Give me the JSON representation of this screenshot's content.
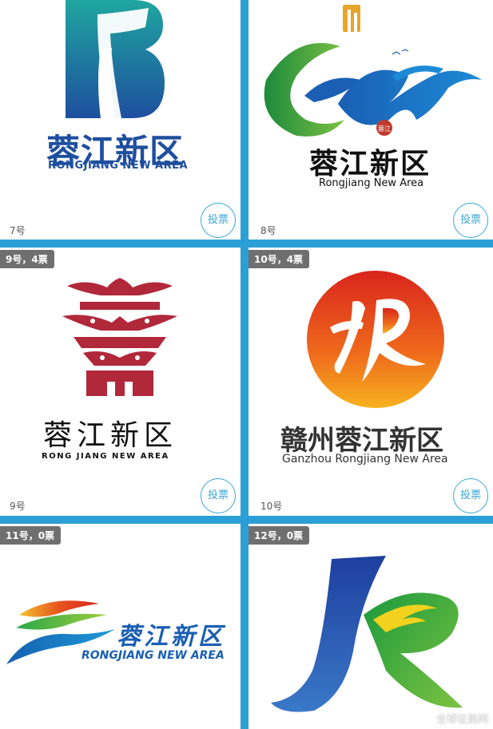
{
  "entries": [
    {
      "number": "7号",
      "vote_label": "投票",
      "cn_title": "蓉江新区",
      "en_title": "RONGJIANG NEW AREA"
    },
    {
      "number": "8号",
      "vote_label": "投票",
      "cn_title": "蓉江新区",
      "en_title": "Rongjiang New Area",
      "seal_text": "蓉江"
    },
    {
      "number": "9号",
      "badge": "9号，4票",
      "vote_label": "投票",
      "cn_title": "蓉江新区",
      "en_title": "RONG JIANG NEW AREA"
    },
    {
      "number": "10号",
      "badge": "10号，4票",
      "vote_label": "投票",
      "cn_title": "赣州蓉江新区",
      "en_title": "Ganzhou Rongjiang New Area"
    },
    {
      "badge": "11号，0票",
      "cn_title": "蓉江新区",
      "en_title": "RONGJIANG NEW AREA"
    },
    {
      "badge": "12号，0票"
    }
  ],
  "watermark": "全球征集网",
  "colors": {
    "accent": "#2a9fd6",
    "badge_bg": "#6f6f6f",
    "logo7_blue": "#1e4f9e",
    "logo9_red": "#b0283a"
  }
}
